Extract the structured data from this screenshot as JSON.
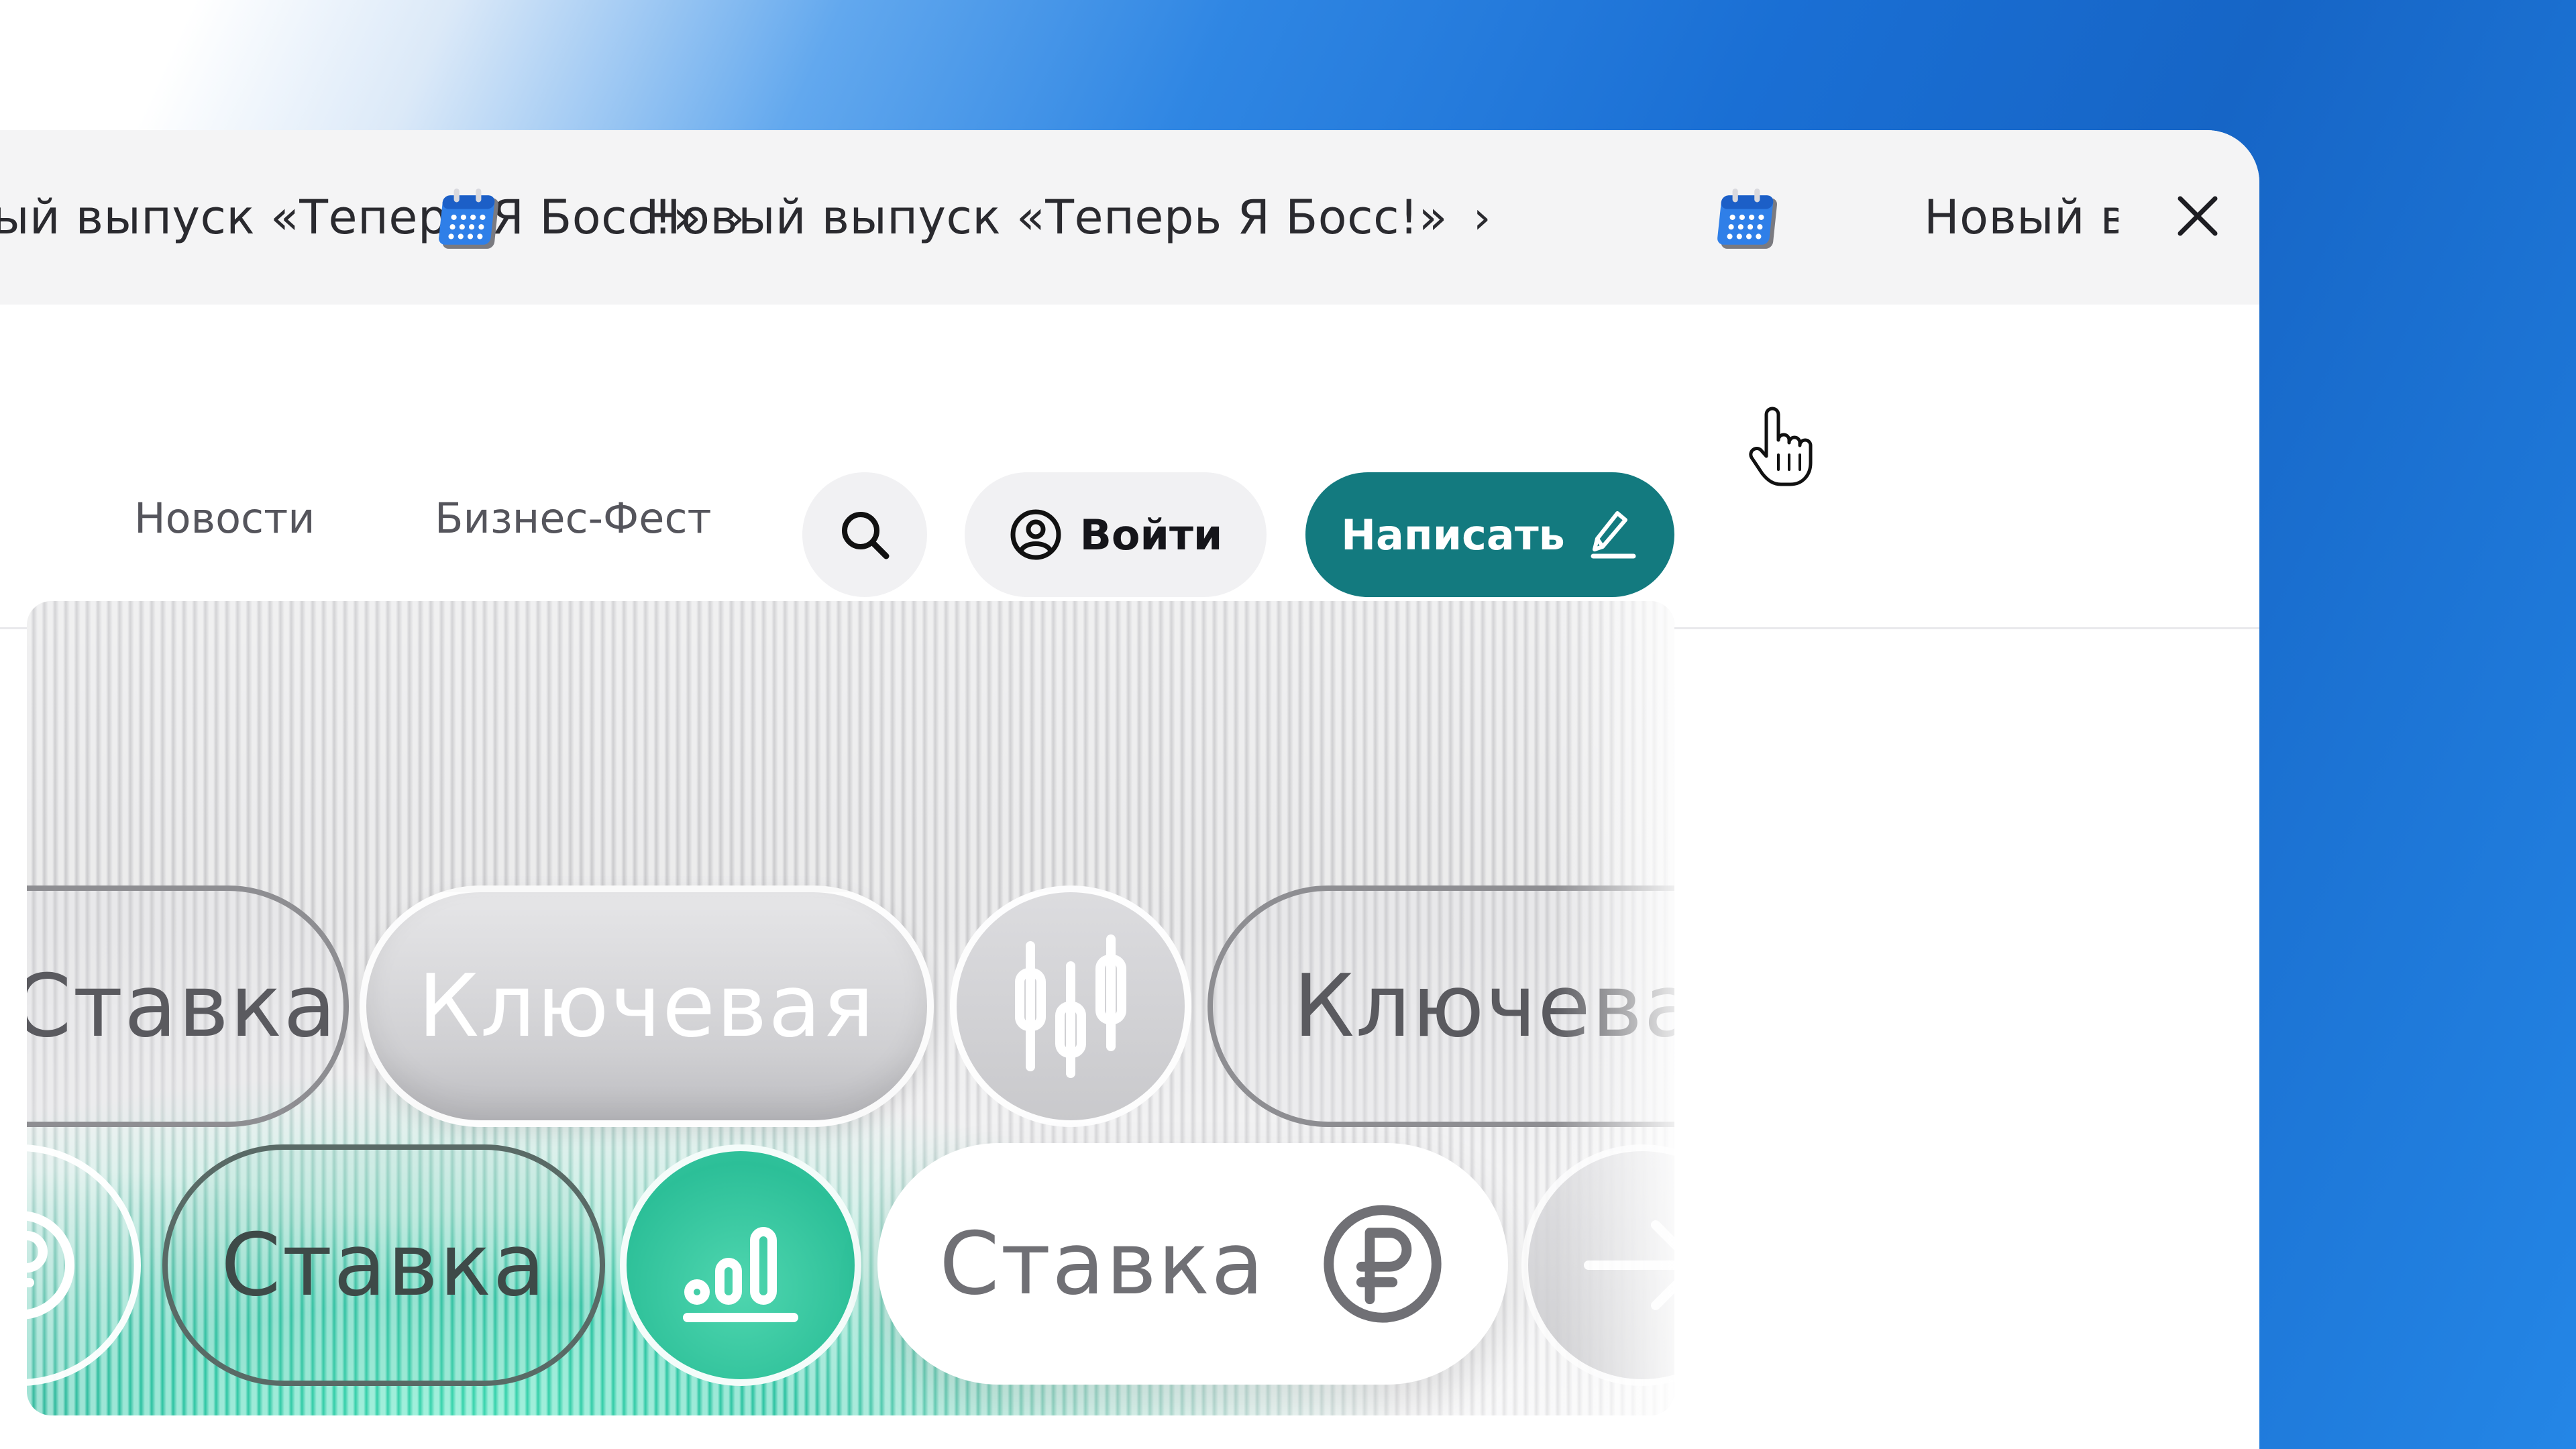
{
  "ticker": {
    "left_text": "Новый выпуск «Теперь Я Босс!»",
    "left_chevron": "›",
    "center_text": "Новый выпуск «Теперь Я Босс!»",
    "center_chevron": "›",
    "right_text": "Новый выпуск",
    "icon": "calendar-icon",
    "close_icon": "close-icon"
  },
  "nav": {
    "news": "Новости",
    "fest": "Бизнес-Фест",
    "search_icon": "search-icon",
    "login_label": "Войти",
    "login_icon": "user-circle-icon",
    "write_label": "Написать",
    "write_icon": "pencil-icon"
  },
  "hero": {
    "row1": [
      "Ставка",
      "Ключевая",
      "candlestick-icon",
      "Ключевая"
    ],
    "row2": [
      "ruble-icon",
      "Ставка",
      "bar-chart-icon",
      "Ставка",
      "ruble-icon",
      "arrow-icon"
    ]
  },
  "colors": {
    "accent": "#137a7f",
    "ticker_bg": "#f4f4f5",
    "button_bg": "#f1f1f3",
    "background_blue": "#1a6fd4"
  }
}
